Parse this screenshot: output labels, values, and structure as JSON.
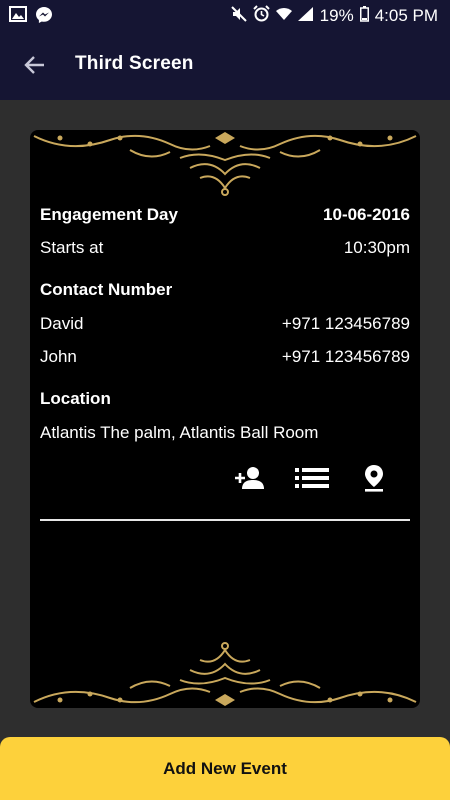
{
  "status_bar": {
    "battery": "19%",
    "time": "4:05 PM"
  },
  "app_bar": {
    "title": "Third Screen"
  },
  "event": {
    "name": "Engagement Day",
    "date": "10-06-2016",
    "starts_label": "Starts at",
    "starts_time": "10:30pm",
    "contact_heading": "Contact Number",
    "contacts": [
      {
        "name": "David",
        "phone": "+971 123456789"
      },
      {
        "name": "John",
        "phone": "+971 123456789"
      }
    ],
    "location_heading": "Location",
    "location": "Atlantis The palm, Atlantis Ball Room"
  },
  "actions": {
    "icons": [
      "add-person-icon",
      "list-icon",
      "location-pin-icon"
    ]
  },
  "add_button": {
    "label": "Add New Event"
  },
  "colors": {
    "app_bar": "#151533",
    "background": "#2e2e2e",
    "card": "#000000",
    "accent_button": "#fdd13b",
    "ornament_gold": "#c9a85c"
  }
}
